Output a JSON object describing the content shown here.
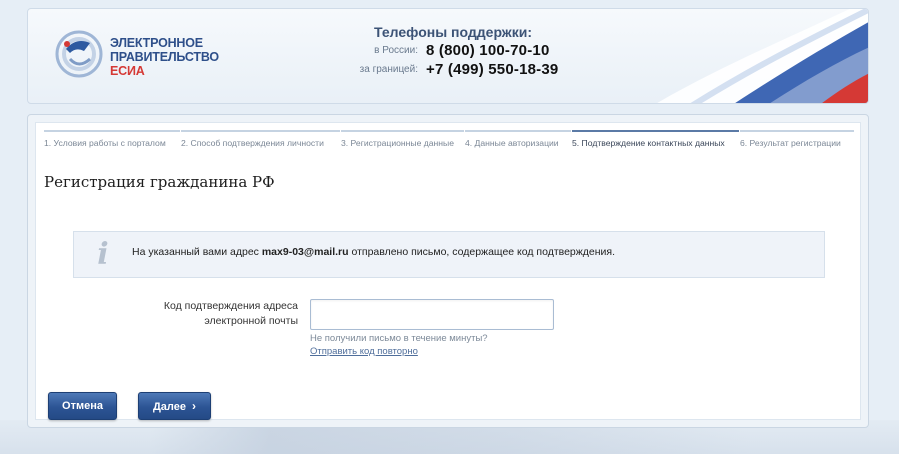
{
  "header": {
    "logo": {
      "line1": "ЭЛЕКТРОННОЕ",
      "line2": "ПРАВИТЕЛЬСТВО",
      "line3": "ЕСИА"
    },
    "support": {
      "title": "Телефоны поддержки:",
      "russia_label": "в России:",
      "russia_phone": "8 (800) 100-70-10",
      "abroad_label": "за границей:",
      "abroad_phone": "+7 (499) 550-18-39"
    }
  },
  "steps": [
    {
      "label": "1. Условия работы с порталом",
      "active": false
    },
    {
      "label": "2. Способ подтверждения личности",
      "active": false
    },
    {
      "label": "3. Регистрационные данные",
      "active": false
    },
    {
      "label": "4. Данные авторизации",
      "active": false
    },
    {
      "label": "5. Подтверждение контактных данных",
      "active": true
    },
    {
      "label": "6. Результат регистрации",
      "active": false
    }
  ],
  "page": {
    "title": "Регистрация гражданина РФ"
  },
  "info": {
    "icon": "info-icon",
    "prefix": "На указанный вами адрес ",
    "email": "max9-03@mail.ru",
    "suffix": " отправлено письмо, содержащее код подтверждения."
  },
  "form": {
    "code_label_line1": "Код подтверждения адреса",
    "code_label_line2": "электронной почты",
    "code_value": "",
    "hint": "Не получили письмо в течение минуты?",
    "resend_link": "Отправить код повторно"
  },
  "buttons": {
    "cancel": "Отмена",
    "next": "Далее"
  },
  "colors": {
    "brand_blue": "#2c5494",
    "flag_red": "#d53935",
    "link": "#4f6e9b"
  }
}
